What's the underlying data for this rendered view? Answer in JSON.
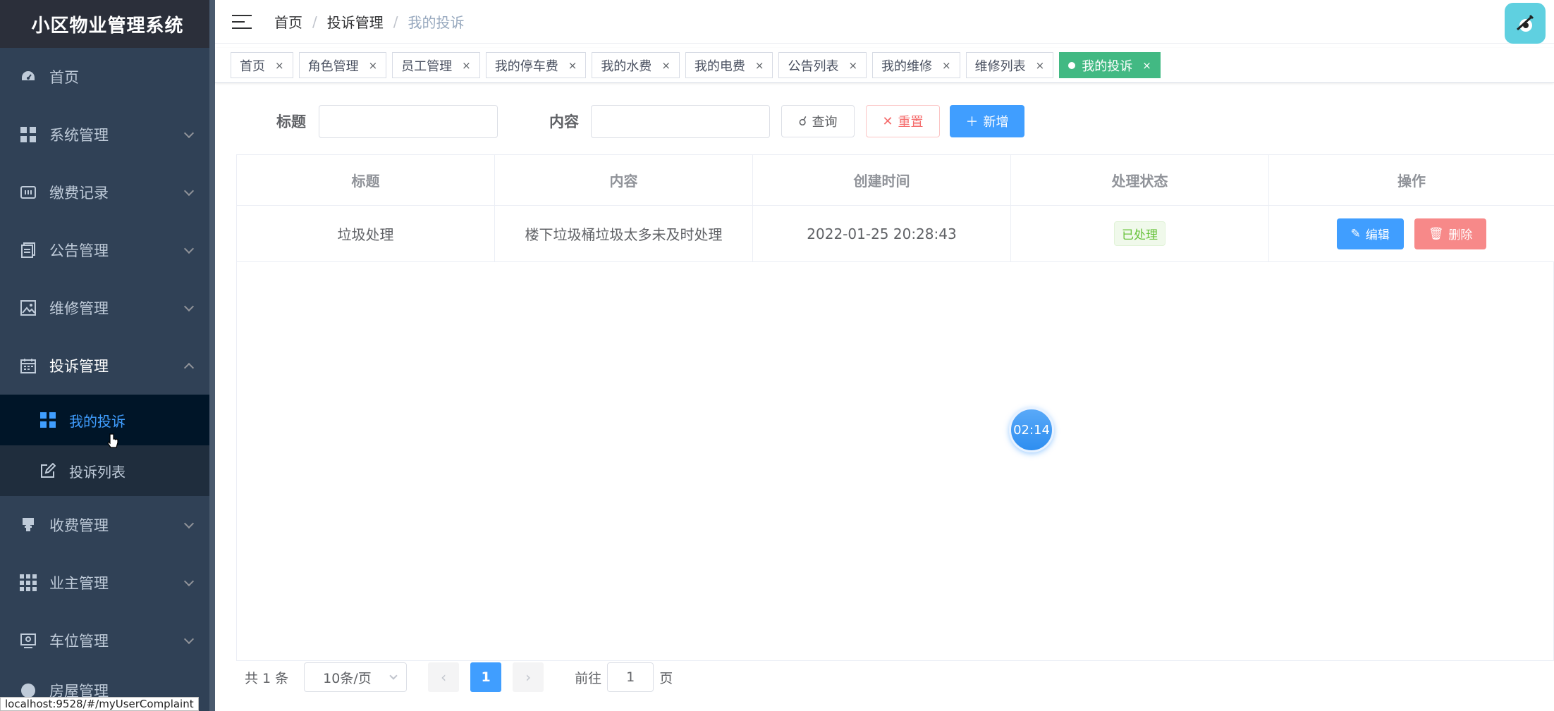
{
  "app": {
    "title": "小区物业管理系统"
  },
  "sidebar": {
    "items": [
      {
        "label": "首页",
        "icon": "dashboard-icon"
      },
      {
        "label": "系统管理",
        "icon": "grid-icon"
      },
      {
        "label": "缴费记录",
        "icon": "receipt-icon"
      },
      {
        "label": "公告管理",
        "icon": "document-icon"
      },
      {
        "label": "维修管理",
        "icon": "image-icon"
      },
      {
        "label": "投诉管理",
        "icon": "calendar-icon"
      },
      {
        "label": "收费管理",
        "icon": "stamp-icon"
      },
      {
        "label": "业主管理",
        "icon": "grid9-icon"
      },
      {
        "label": "车位管理",
        "icon": "parking-icon"
      },
      {
        "label": "房屋管理",
        "icon": "house-icon"
      }
    ],
    "submenu": [
      {
        "label": "我的投诉",
        "icon": "grid-icon"
      },
      {
        "label": "投诉列表",
        "icon": "edit-icon"
      }
    ]
  },
  "breadcrumb": [
    "首页",
    "投诉管理",
    "我的投诉"
  ],
  "tags": [
    {
      "label": "首页"
    },
    {
      "label": "角色管理"
    },
    {
      "label": "员工管理"
    },
    {
      "label": "我的停车费"
    },
    {
      "label": "我的水费"
    },
    {
      "label": "我的电费"
    },
    {
      "label": "公告列表"
    },
    {
      "label": "我的维修"
    },
    {
      "label": "维修列表"
    },
    {
      "label": "我的投诉"
    }
  ],
  "tag_close": "×",
  "filter": {
    "title_label": "标题",
    "content_label": "内容",
    "query": "查询",
    "reset": "重置",
    "add": "新增"
  },
  "table": {
    "headers": [
      "标题",
      "内容",
      "创建时间",
      "处理状态",
      "操作"
    ],
    "rows": [
      {
        "title": "垃圾处理",
        "content": "楼下垃圾桶垃圾太多未及时处理",
        "created": "2022-01-25 20:28:43",
        "status": "已处理"
      }
    ],
    "edit": "编辑",
    "delete": "删除"
  },
  "timer": "02:14",
  "pagination": {
    "total": "共 1 条",
    "size": "10条/页",
    "current": "1",
    "goto": "前往",
    "goto_value": "1",
    "page_suffix": "页"
  },
  "status_url": "localhost:9528/#/myUserComplaint",
  "colors": {
    "primary": "#409eff",
    "sidebar": "#304156",
    "active_tag": "#42b983",
    "danger": "#f78989",
    "success": "#67c23a"
  }
}
